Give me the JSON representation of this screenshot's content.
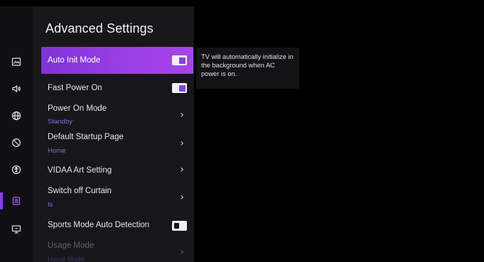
{
  "page": {
    "title": "Advanced Settings"
  },
  "colors": {
    "accent": "#8b3fe0",
    "panel_bg": "#17171a",
    "sub_text": "#8a6bd8"
  },
  "rail": {
    "items": [
      {
        "icon": "picture-icon"
      },
      {
        "icon": "sound-icon"
      },
      {
        "icon": "globe-icon"
      },
      {
        "icon": "privacy-icon"
      },
      {
        "icon": "accessibility-icon"
      },
      {
        "icon": "system-icon",
        "active": true
      },
      {
        "icon": "support-icon"
      }
    ]
  },
  "settings": {
    "auto_init": {
      "label": "Auto Init Mode",
      "checked": true
    },
    "fast_power": {
      "label": "Fast Power On",
      "checked": true
    },
    "power_on_mode": {
      "label": "Power On Mode",
      "value": "Standby"
    },
    "default_startup": {
      "label": "Default Startup Page",
      "value": "Home"
    },
    "vidaa_art": {
      "label": "VIDAA Art Setting"
    },
    "switch_off_curtain": {
      "label": "Switch off Curtain",
      "value": "Is"
    },
    "sports_mode": {
      "label": "Sports Mode Auto Detection",
      "checked": false
    },
    "usage_mode": {
      "label": "Usage Mode",
      "value": "Home Mode"
    }
  },
  "description": {
    "text": "TV will automatically initialize in the background when AC power is on."
  }
}
